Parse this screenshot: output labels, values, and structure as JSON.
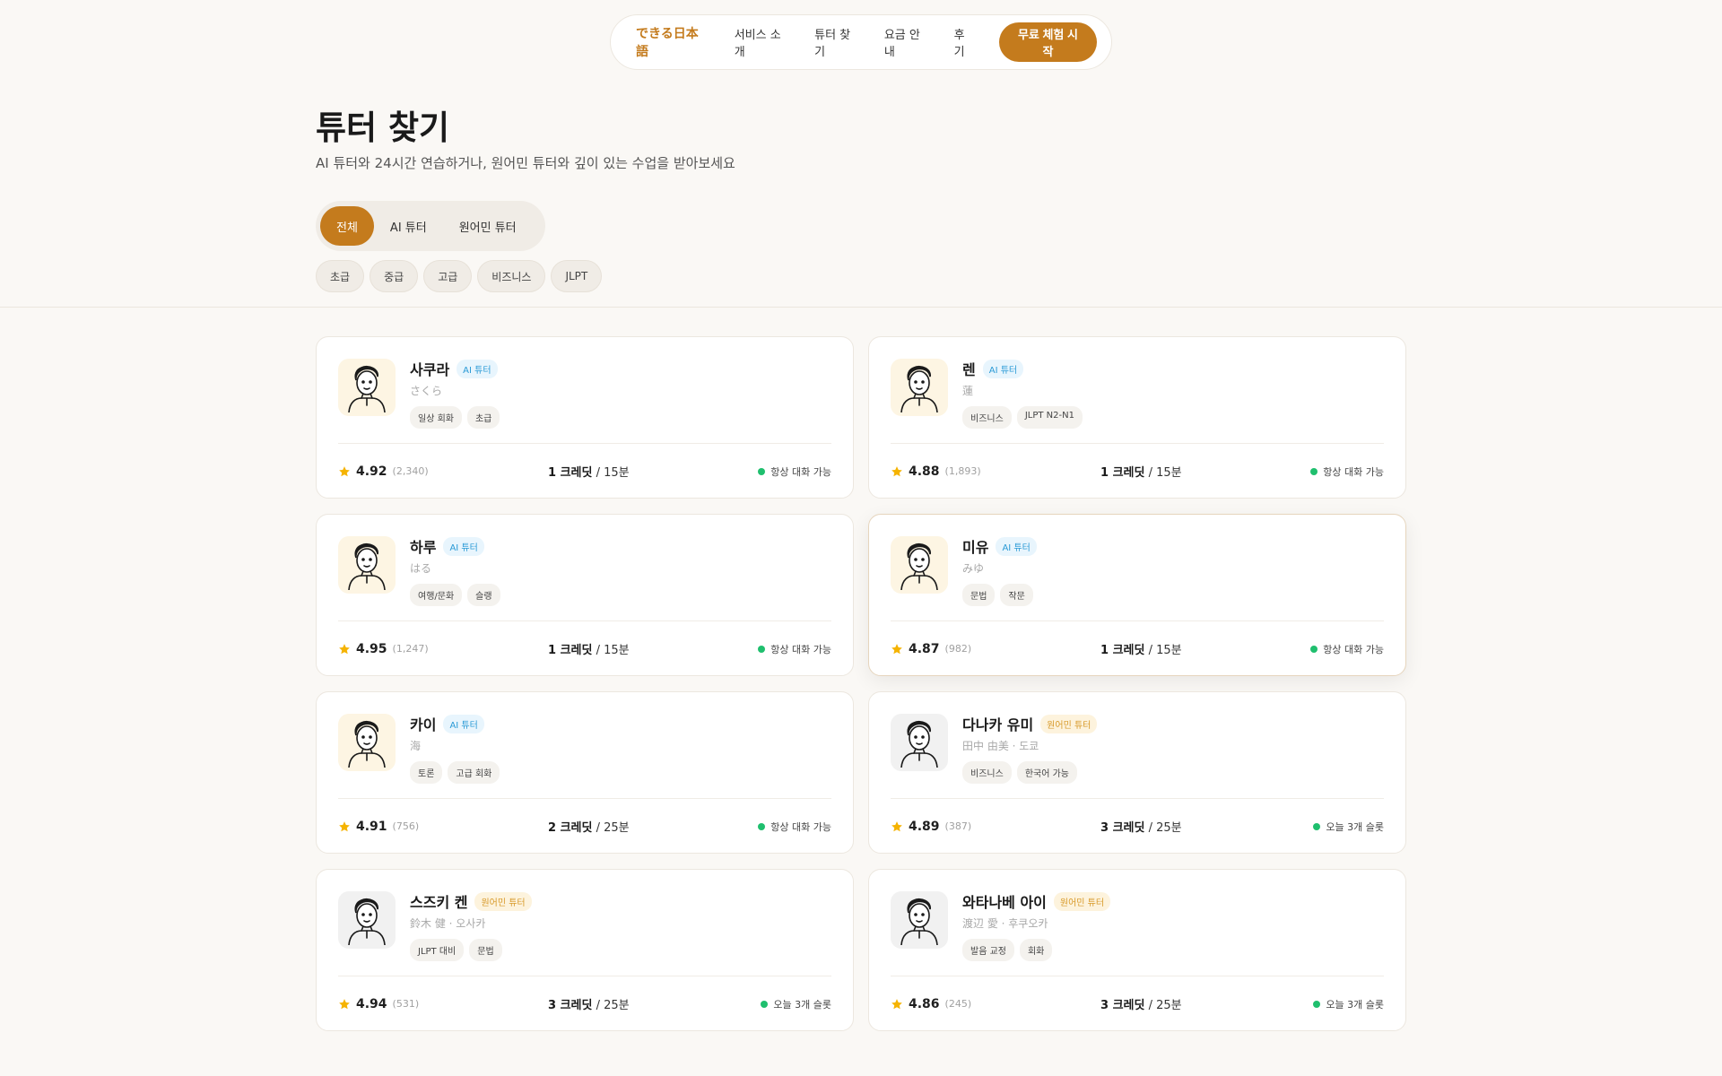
{
  "nav": {
    "brand": "できる日本語",
    "links": [
      "서비스 소개",
      "튜터 찾기",
      "요금 안내",
      "후기"
    ],
    "cta": "무료 체험 시작"
  },
  "header": {
    "title": "튜터 찾기",
    "subtitle": "AI 튜터와 24시간 연습하거나, 원어민 튜터와 깊이 있는 수업을 받아보세요"
  },
  "segments": [
    "전체",
    "AI 튜터",
    "원어민 튜터"
  ],
  "active_segment": "전체",
  "level_filters": [
    "초급",
    "중급",
    "고급",
    "비즈니스",
    "JLPT"
  ],
  "colors": {
    "accent": "#c47b1d",
    "ai_badge": "#2a9ad6",
    "native_badge": "#d89a2a",
    "status_dot": "#1fbf6e",
    "star": "#f5b301"
  },
  "tutors": [
    {
      "name": "사쿠라",
      "badge": "AI 튜터",
      "type": "ai",
      "sub": "さくら",
      "tags": [
        "일상 회화",
        "초급"
      ],
      "rating": "4.92",
      "reviews": "(2,340)",
      "credit": "1 크레딧",
      "duration": "/ 15분",
      "status": "항상 대화 가능",
      "avatar_icon": "woman-avatar-icon"
    },
    {
      "name": "렌",
      "badge": "AI 튜터",
      "type": "ai",
      "sub": "蓮",
      "tags": [
        "비즈니스",
        "JLPT N2-N1"
      ],
      "rating": "4.88",
      "reviews": "(1,893)",
      "credit": "1 크레딧",
      "duration": "/ 15분",
      "status": "항상 대화 가능",
      "avatar_icon": "woman-avatar-icon"
    },
    {
      "name": "하루",
      "badge": "AI 튜터",
      "type": "ai",
      "sub": "はる",
      "tags": [
        "여행/문화",
        "슬랭"
      ],
      "rating": "4.95",
      "reviews": "(1,247)",
      "credit": "1 크레딧",
      "duration": "/ 15분",
      "status": "항상 대화 가능",
      "avatar_icon": "man-avatar-icon"
    },
    {
      "name": "미유",
      "badge": "AI 튜터",
      "type": "ai",
      "sub": "みゆ",
      "tags": [
        "문법",
        "작문"
      ],
      "rating": "4.87",
      "reviews": "(982)",
      "credit": "1 크레딧",
      "duration": "/ 15분",
      "status": "항상 대화 가능",
      "avatar_icon": "man-avatar-icon"
    },
    {
      "name": "카이",
      "badge": "AI 튜터",
      "type": "ai",
      "sub": "海",
      "tags": [
        "토론",
        "고급 회화"
      ],
      "rating": "4.91",
      "reviews": "(756)",
      "credit": "2 크레딧",
      "duration": "/ 25분",
      "status": "항상 대화 가능",
      "avatar_icon": "woman-avatar-icon"
    },
    {
      "name": "다나카 유미",
      "badge": "원어민 튜터",
      "type": "native",
      "sub": "田中 由美 · 도쿄",
      "tags": [
        "비즈니스",
        "한국어 가능"
      ],
      "rating": "4.89",
      "reviews": "(387)",
      "credit": "3 크레딧",
      "duration": "/ 25분",
      "status": "오늘 3개 슬롯",
      "avatar_icon": "man-avatar-icon"
    },
    {
      "name": "스즈키 켄",
      "badge": "원어민 튜터",
      "type": "native",
      "sub": "鈴木 健 · 오사카",
      "tags": [
        "JLPT 대비",
        "문법"
      ],
      "rating": "4.94",
      "reviews": "(531)",
      "credit": "3 크레딧",
      "duration": "/ 25분",
      "status": "오늘 3개 슬롯",
      "avatar_icon": "man-avatar-icon"
    },
    {
      "name": "와타나베 아이",
      "badge": "원어민 튜터",
      "type": "native",
      "sub": "渡辺 愛 · 후쿠오카",
      "tags": [
        "발음 교정",
        "회화"
      ],
      "rating": "4.86",
      "reviews": "(245)",
      "credit": "3 크레딧",
      "duration": "/ 25분",
      "status": "오늘 3개 슬롯",
      "avatar_icon": "man-avatar-icon"
    }
  ]
}
